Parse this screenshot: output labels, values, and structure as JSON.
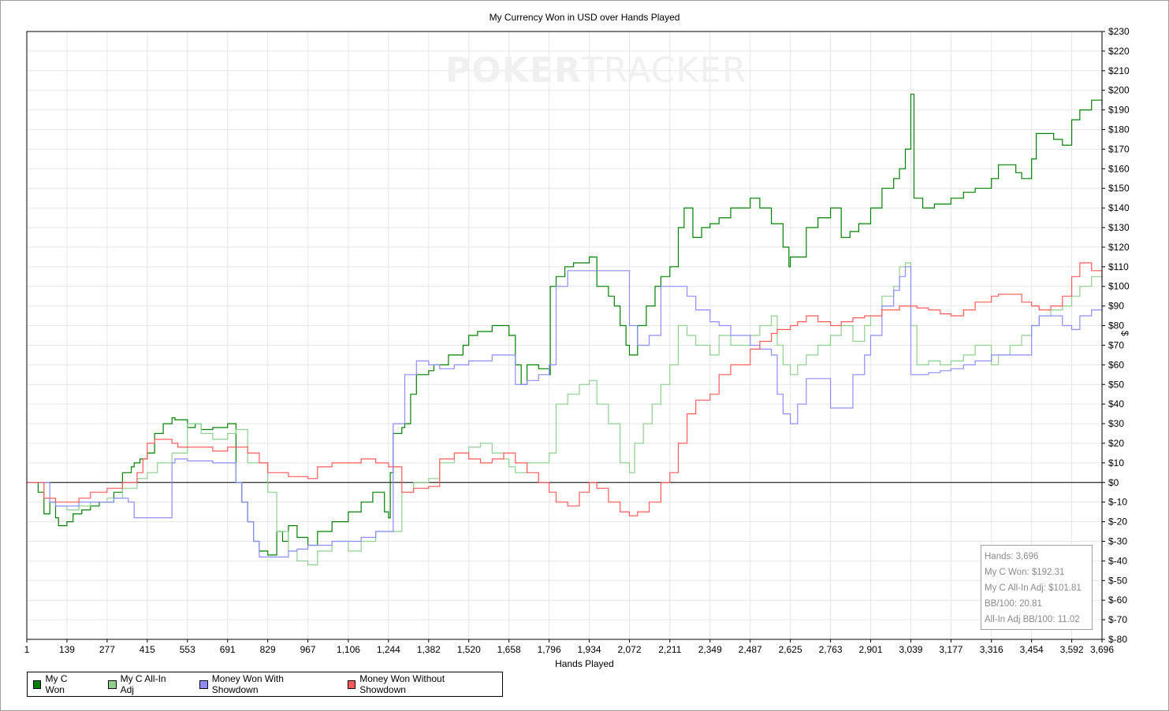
{
  "chart_data": {
    "type": "line",
    "title": "My Currency Won in USD over Hands Played",
    "xlabel": "Hands Played",
    "ylabel": "$",
    "xlim": [
      1,
      3696
    ],
    "ylim": [
      -80,
      230
    ],
    "x_ticks": [
      "1",
      "139",
      "277",
      "415",
      "553",
      "691",
      "829",
      "967",
      "1,106",
      "1,244",
      "1,382",
      "1,520",
      "1,658",
      "1,796",
      "1,934",
      "2,072",
      "2,211",
      "2,349",
      "2,487",
      "2,625",
      "2,763",
      "2,901",
      "3,039",
      "3,177",
      "3,316",
      "3,454",
      "3,592",
      "3,696"
    ],
    "x_tick_values": [
      1,
      139,
      277,
      415,
      553,
      691,
      829,
      967,
      1106,
      1244,
      1382,
      1520,
      1658,
      1796,
      1934,
      2072,
      2211,
      2349,
      2487,
      2625,
      2763,
      2901,
      3039,
      3177,
      3316,
      3454,
      3592,
      3696
    ],
    "y_tick_values": [
      -80,
      -70,
      -60,
      -50,
      -40,
      -30,
      -20,
      -10,
      0,
      10,
      20,
      30,
      40,
      50,
      60,
      70,
      80,
      90,
      100,
      110,
      120,
      130,
      140,
      150,
      160,
      170,
      180,
      190,
      200,
      210,
      220,
      230
    ],
    "y_tick_labels": [
      "$-80",
      "$-70",
      "$-60",
      "$-50",
      "$-40",
      "$-30",
      "$-20",
      "$-10",
      "$0",
      "$10",
      "$20",
      "$30",
      "$40",
      "$50",
      "$60",
      "$70",
      "$80",
      "$90",
      "$100",
      "$110",
      "$120",
      "$130",
      "$140",
      "$150",
      "$160",
      "$170",
      "$180",
      "$190",
      "$200",
      "$210",
      "$220",
      "$230"
    ],
    "grid": true,
    "legend_position": "bottom-left",
    "series": [
      {
        "name": "My C Won",
        "color": "#008000",
        "x": [
          1,
          40,
          60,
          80,
          100,
          110,
          139,
          160,
          190,
          220,
          250,
          277,
          300,
          330,
          360,
          370,
          390,
          415,
          440,
          470,
          500,
          510,
          553,
          580,
          600,
          640,
          691,
          720,
          740,
          760,
          780,
          800,
          829,
          860,
          880,
          900,
          930,
          967,
          1000,
          1050,
          1106,
          1150,
          1190,
          1230,
          1244,
          1250,
          1260,
          1290,
          1300,
          1320,
          1340,
          1382,
          1400,
          1450,
          1500,
          1520,
          1550,
          1600,
          1658,
          1680,
          1700,
          1720,
          1760,
          1796,
          1800,
          1820,
          1850,
          1880,
          1934,
          1960,
          2000,
          2020,
          2040,
          2060,
          2072,
          2100,
          2130,
          2160,
          2180,
          2211,
          2240,
          2260,
          2290,
          2320,
          2349,
          2380,
          2420,
          2487,
          2520,
          2560,
          2600,
          2620,
          2625,
          2650,
          2680,
          2720,
          2763,
          2800,
          2830,
          2860,
          2901,
          2940,
          2980,
          3000,
          3020,
          3039,
          3050,
          3080,
          3120,
          3177,
          3220,
          3260,
          3316,
          3340,
          3380,
          3400,
          3420,
          3454,
          3470,
          3500,
          3530,
          3560,
          3592,
          3620,
          3660,
          3696
        ],
        "y": [
          0,
          -5,
          -16,
          -10,
          -18,
          -22,
          -20,
          -16,
          -14,
          -12,
          -10,
          -10,
          -5,
          5,
          8,
          10,
          12,
          15,
          25,
          30,
          33,
          32,
          28,
          30,
          27,
          28,
          30,
          0,
          -10,
          -20,
          -30,
          -35,
          -37,
          -25,
          -30,
          -22,
          -28,
          -32,
          -25,
          -20,
          -15,
          -10,
          -5,
          -15,
          -18,
          5,
          25,
          28,
          30,
          45,
          55,
          57,
          60,
          65,
          70,
          75,
          77,
          80,
          75,
          60,
          50,
          60,
          58,
          55,
          100,
          105,
          110,
          112,
          115,
          100,
          95,
          90,
          80,
          70,
          65,
          80,
          90,
          100,
          105,
          110,
          130,
          140,
          125,
          130,
          132,
          135,
          140,
          145,
          140,
          132,
          120,
          110,
          115,
          115,
          130,
          135,
          140,
          125,
          128,
          132,
          140,
          150,
          155,
          160,
          170,
          198,
          145,
          140,
          142,
          145,
          148,
          150,
          155,
          162,
          162,
          158,
          155,
          165,
          178,
          178,
          175,
          172,
          185,
          190,
          195,
          192
        ]
      },
      {
        "name": "My C All-In Adj",
        "color": "#8fcf8f",
        "x": [
          1,
          60,
          100,
          139,
          180,
          220,
          277,
          330,
          380,
          415,
          450,
          500,
          553,
          600,
          640,
          691,
          720,
          760,
          829,
          860,
          900,
          930,
          967,
          1000,
          1050,
          1106,
          1150,
          1200,
          1244,
          1290,
          1330,
          1382,
          1420,
          1470,
          1520,
          1560,
          1600,
          1640,
          1658,
          1680,
          1720,
          1796,
          1820,
          1860,
          1900,
          1934,
          1960,
          2000,
          2040,
          2072,
          2090,
          2120,
          2150,
          2180,
          2211,
          2240,
          2270,
          2300,
          2349,
          2380,
          2420,
          2487,
          2520,
          2560,
          2580,
          2600,
          2625,
          2650,
          2680,
          2720,
          2763,
          2800,
          2840,
          2880,
          2901,
          2940,
          2980,
          3000,
          3020,
          3039,
          3060,
          3100,
          3140,
          3177,
          3220,
          3260,
          3316,
          3340,
          3380,
          3420,
          3454,
          3480,
          3520,
          3560,
          3592,
          3620,
          3660,
          3696
        ],
        "y": [
          0,
          -8,
          -12,
          -14,
          -12,
          -10,
          -8,
          -3,
          2,
          5,
          10,
          15,
          30,
          25,
          22,
          25,
          27,
          10,
          -5,
          -25,
          -35,
          -40,
          -42,
          -35,
          -30,
          -35,
          -30,
          -25,
          -25,
          -5,
          0,
          2,
          10,
          15,
          18,
          20,
          15,
          12,
          8,
          5,
          10,
          15,
          40,
          45,
          50,
          52,
          40,
          30,
          10,
          5,
          20,
          30,
          40,
          50,
          60,
          80,
          75,
          70,
          65,
          75,
          70,
          75,
          80,
          85,
          70,
          60,
          55,
          60,
          65,
          70,
          75,
          80,
          72,
          80,
          85,
          95,
          100,
          110,
          112,
          80,
          60,
          62,
          60,
          62,
          65,
          70,
          60,
          65,
          70,
          75,
          80,
          85,
          88,
          90,
          95,
          100,
          105,
          102
        ]
      },
      {
        "name": "Money Won With Showdown",
        "color": "#8c8cff",
        "x": [
          1,
          60,
          80,
          100,
          139,
          180,
          220,
          277,
          300,
          350,
          370,
          415,
          430,
          470,
          500,
          510,
          553,
          600,
          640,
          691,
          720,
          740,
          760,
          780,
          800,
          829,
          860,
          880,
          900,
          930,
          967,
          1000,
          1050,
          1106,
          1150,
          1200,
          1244,
          1260,
          1300,
          1340,
          1382,
          1420,
          1470,
          1520,
          1560,
          1600,
          1640,
          1658,
          1680,
          1720,
          1760,
          1796,
          1820,
          1860,
          1900,
          1934,
          1960,
          2000,
          2040,
          2072,
          2100,
          2140,
          2180,
          2211,
          2240,
          2270,
          2300,
          2349,
          2380,
          2420,
          2487,
          2520,
          2560,
          2580,
          2600,
          2625,
          2650,
          2680,
          2720,
          2763,
          2800,
          2840,
          2880,
          2901,
          2940,
          2980,
          3000,
          3020,
          3039,
          3060,
          3100,
          3140,
          3177,
          3220,
          3260,
          3316,
          3340,
          3380,
          3420,
          3454,
          3480,
          3520,
          3560,
          3592,
          3620,
          3660,
          3696
        ],
        "y": [
          0,
          0,
          -10,
          -12,
          -12,
          -10,
          -10,
          -10,
          -8,
          -10,
          -18,
          -18,
          -18,
          -18,
          10,
          12,
          11,
          11,
          10,
          10,
          0,
          -10,
          -20,
          -30,
          -38,
          -38,
          -38,
          -38,
          -35,
          -34,
          -32,
          -32,
          -30,
          -30,
          -28,
          -25,
          -25,
          30,
          55,
          62,
          60,
          58,
          60,
          62,
          62,
          65,
          65,
          65,
          50,
          52,
          55,
          60,
          100,
          108,
          108,
          108,
          108,
          108,
          108,
          80,
          70,
          75,
          100,
          100,
          100,
          95,
          88,
          82,
          80,
          75,
          70,
          68,
          65,
          45,
          35,
          30,
          40,
          53,
          53,
          38,
          38,
          55,
          65,
          75,
          90,
          98,
          105,
          110,
          55,
          55,
          56,
          57,
          58,
          60,
          62,
          65,
          65,
          65,
          65,
          80,
          85,
          85,
          80,
          78,
          85,
          88,
          90
        ]
      },
      {
        "name": "Money Won Without Showdown",
        "color": "#ff5a5a",
        "x": [
          1,
          60,
          100,
          139,
          180,
          220,
          277,
          330,
          380,
          400,
          415,
          440,
          470,
          500,
          520,
          553,
          600,
          640,
          691,
          720,
          760,
          800,
          829,
          860,
          900,
          930,
          967,
          1000,
          1050,
          1106,
          1150,
          1200,
          1244,
          1290,
          1330,
          1382,
          1420,
          1470,
          1520,
          1560,
          1600,
          1640,
          1658,
          1680,
          1720,
          1760,
          1796,
          1820,
          1860,
          1900,
          1934,
          1960,
          2000,
          2040,
          2072,
          2100,
          2140,
          2180,
          2211,
          2240,
          2270,
          2300,
          2349,
          2380,
          2420,
          2487,
          2520,
          2560,
          2580,
          2600,
          2625,
          2650,
          2680,
          2720,
          2763,
          2800,
          2840,
          2880,
          2901,
          2940,
          2980,
          3000,
          3020,
          3039,
          3060,
          3100,
          3140,
          3177,
          3220,
          3260,
          3316,
          3340,
          3380,
          3420,
          3454,
          3480,
          3520,
          3560,
          3592,
          3620,
          3660,
          3696
        ],
        "y": [
          0,
          -8,
          -10,
          -10,
          -8,
          -5,
          -3,
          0,
          5,
          12,
          20,
          22,
          22,
          20,
          18,
          18,
          18,
          16,
          18,
          18,
          15,
          10,
          5,
          5,
          3,
          3,
          2,
          8,
          10,
          10,
          12,
          10,
          8,
          -5,
          -3,
          -2,
          12,
          15,
          12,
          10,
          12,
          15,
          15,
          10,
          5,
          0,
          -5,
          -10,
          -12,
          -5,
          0,
          -3,
          -10,
          -15,
          -17,
          -15,
          -10,
          0,
          5,
          20,
          35,
          42,
          45,
          55,
          60,
          68,
          72,
          76,
          78,
          78,
          80,
          82,
          85,
          82,
          80,
          82,
          84,
          85,
          85,
          88,
          88,
          90,
          90,
          90,
          89,
          88,
          86,
          85,
          88,
          92,
          95,
          96,
          96,
          92,
          90,
          88,
          90,
          95,
          105,
          112,
          108,
          104
        ]
      }
    ]
  },
  "watermark": {
    "bold": "POKER",
    "light": "TRACKER"
  },
  "stats": {
    "hands": "Hands: 3,696",
    "won": "My C Won: $192.31",
    "allin": "My C All-In Adj: $101.81",
    "bb100": "BB/100: 20.81",
    "allin_bb100": "All-In Adj BB/100: 11.02"
  }
}
